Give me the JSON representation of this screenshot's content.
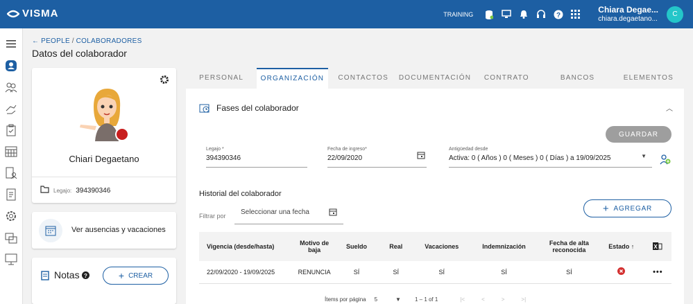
{
  "header": {
    "brand": "VISMA",
    "training": "TRAINING",
    "user_name": "Chiara Degae...",
    "user_email": "chiara.degaetano...",
    "avatar_letter": "C"
  },
  "breadcrumb": {
    "people": "PEOPLE",
    "sep": "/",
    "colaboradores": "COLABORADORES"
  },
  "page_title": "Datos del colaborador",
  "profile": {
    "name": "Chiari Degaetano",
    "legajo_label": "Legajo:",
    "legajo_value": "394390346"
  },
  "ausencias_label": "Ver ausencias y vacaciones",
  "notas": {
    "title": "Notas",
    "create": "CREAR"
  },
  "tabs": [
    "PERSONAL",
    "ORGANIZACIÓN",
    "CONTACTOS",
    "DOCUMENTACIÓN",
    "CONTRATO",
    "BANCOS",
    "ELEMENTOS"
  ],
  "section": {
    "title": "Fases del colaborador",
    "save": "GUARDAR"
  },
  "fields": {
    "legajo_label": "Legajo *",
    "legajo_value": "394390346",
    "fecha_label": "Fecha de ingreso*",
    "fecha_value": "22/09/2020",
    "antig_label": "Antigüedad desde",
    "antig_value": "Activa: 0 ( Años ) 0 ( Meses ) 0 ( Días ) a 19/09/2025"
  },
  "historial": {
    "title": "Historial del colaborador",
    "filter_label": "Filtrar por",
    "filter_placeholder": "Seleccionar una fecha",
    "add": "AGREGAR"
  },
  "table": {
    "headers": [
      "Vigencia (desde/hasta)",
      "Motivo de baja",
      "Sueldo",
      "Real",
      "Vacaciones",
      "Indemnización",
      "Fecha de alta reconocida",
      "Estado ↑"
    ],
    "row": [
      "22/09/2020 - 19/09/2025",
      "RENUNCIA",
      "SÍ",
      "SÍ",
      "SÍ",
      "SÍ",
      "SÍ"
    ]
  },
  "pager": {
    "items_label": "Ítems por página",
    "page_size": "5",
    "range": "1 – 1 of 1"
  },
  "colors": {
    "primary": "#1d5fa3",
    "avatar": "#24c6c9",
    "status": "#d32f2f"
  }
}
